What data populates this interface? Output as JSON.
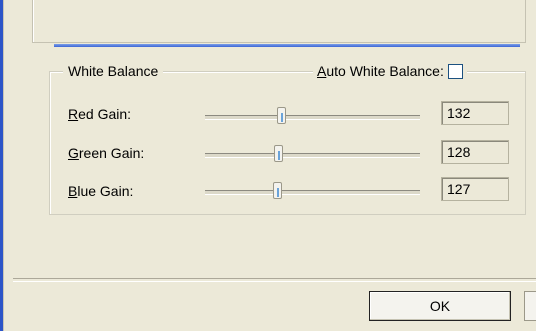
{
  "white_balance": {
    "group_title": "White Balance",
    "auto_label": "Auto White Balance:",
    "auto_checked": false,
    "rows": [
      {
        "label": "Red Gain:",
        "value": "132",
        "level": 0.35
      },
      {
        "label": "Green Gain:",
        "value": "128",
        "level": 0.335
      },
      {
        "label": "Blue Gain:",
        "value": "127",
        "level": 0.33
      }
    ]
  },
  "buttons": {
    "ok": "OK"
  }
}
